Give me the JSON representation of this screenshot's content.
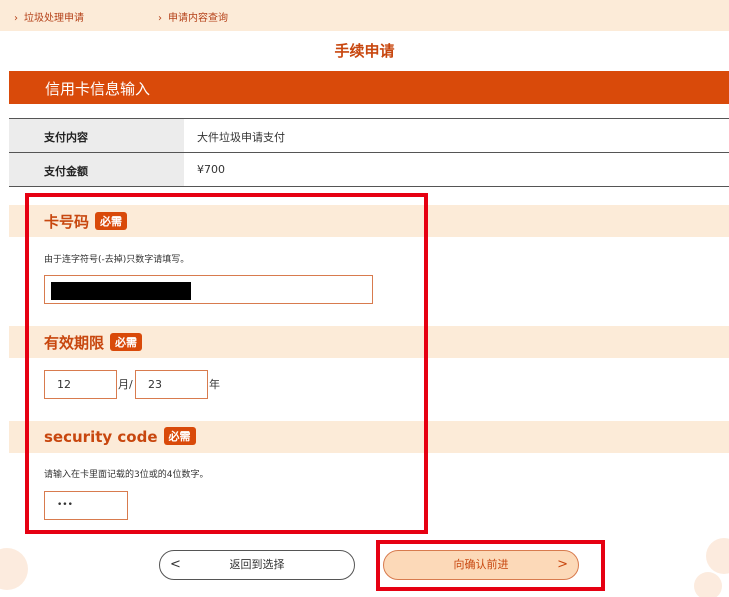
{
  "breadcrumbs": [
    {
      "label": "垃圾处理申请"
    },
    {
      "label": "申请内容查询"
    }
  ],
  "page_title": "手续申请",
  "section_title": "信用卡信息输入",
  "payment": [
    {
      "label": "支付内容",
      "value": "大件垃圾申请支付"
    },
    {
      "label": "支付金额",
      "value": "¥700"
    }
  ],
  "required_label": "必需",
  "card_number": {
    "title": "卡号码",
    "hint": "由于连字符号(-去掉)只数字请填写。"
  },
  "expiry": {
    "title": "有效期限",
    "month": "12",
    "month_sep": "月/",
    "year": "23",
    "year_label": "年"
  },
  "security_code": {
    "title": "security code",
    "hint": "请输入在卡里面记载的3位或的4位数字。",
    "value": "•••"
  },
  "buttons": {
    "back_label": "返回到选择",
    "back_arrow": "<",
    "next_label": "向确认前进",
    "next_arrow": ">"
  },
  "colors": {
    "accent": "#d94a0a",
    "band": "#fcebd8",
    "highlight": "#e60012"
  }
}
